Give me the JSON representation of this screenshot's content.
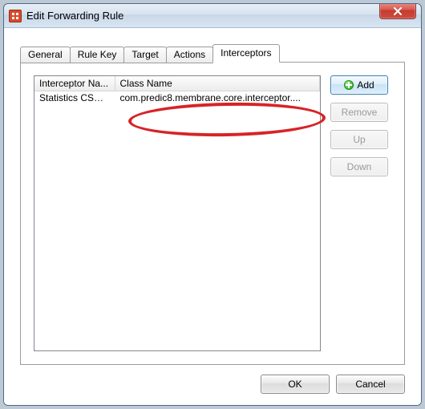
{
  "window": {
    "title": "Edit Forwarding Rule"
  },
  "tabs": {
    "items": [
      {
        "label": "General"
      },
      {
        "label": "Rule Key"
      },
      {
        "label": "Target"
      },
      {
        "label": "Actions"
      },
      {
        "label": "Interceptors"
      }
    ],
    "active_index": 4
  },
  "table": {
    "columns": [
      "Interceptor Na...",
      "Class Name"
    ],
    "rows": [
      {
        "name": "Statistics CSV L...",
        "class": "com.predic8.membrane.core.interceptor...."
      }
    ]
  },
  "side_buttons": {
    "add": "Add",
    "remove": "Remove",
    "up": "Up",
    "down": "Down"
  },
  "bottom": {
    "ok": "OK",
    "cancel": "Cancel"
  }
}
